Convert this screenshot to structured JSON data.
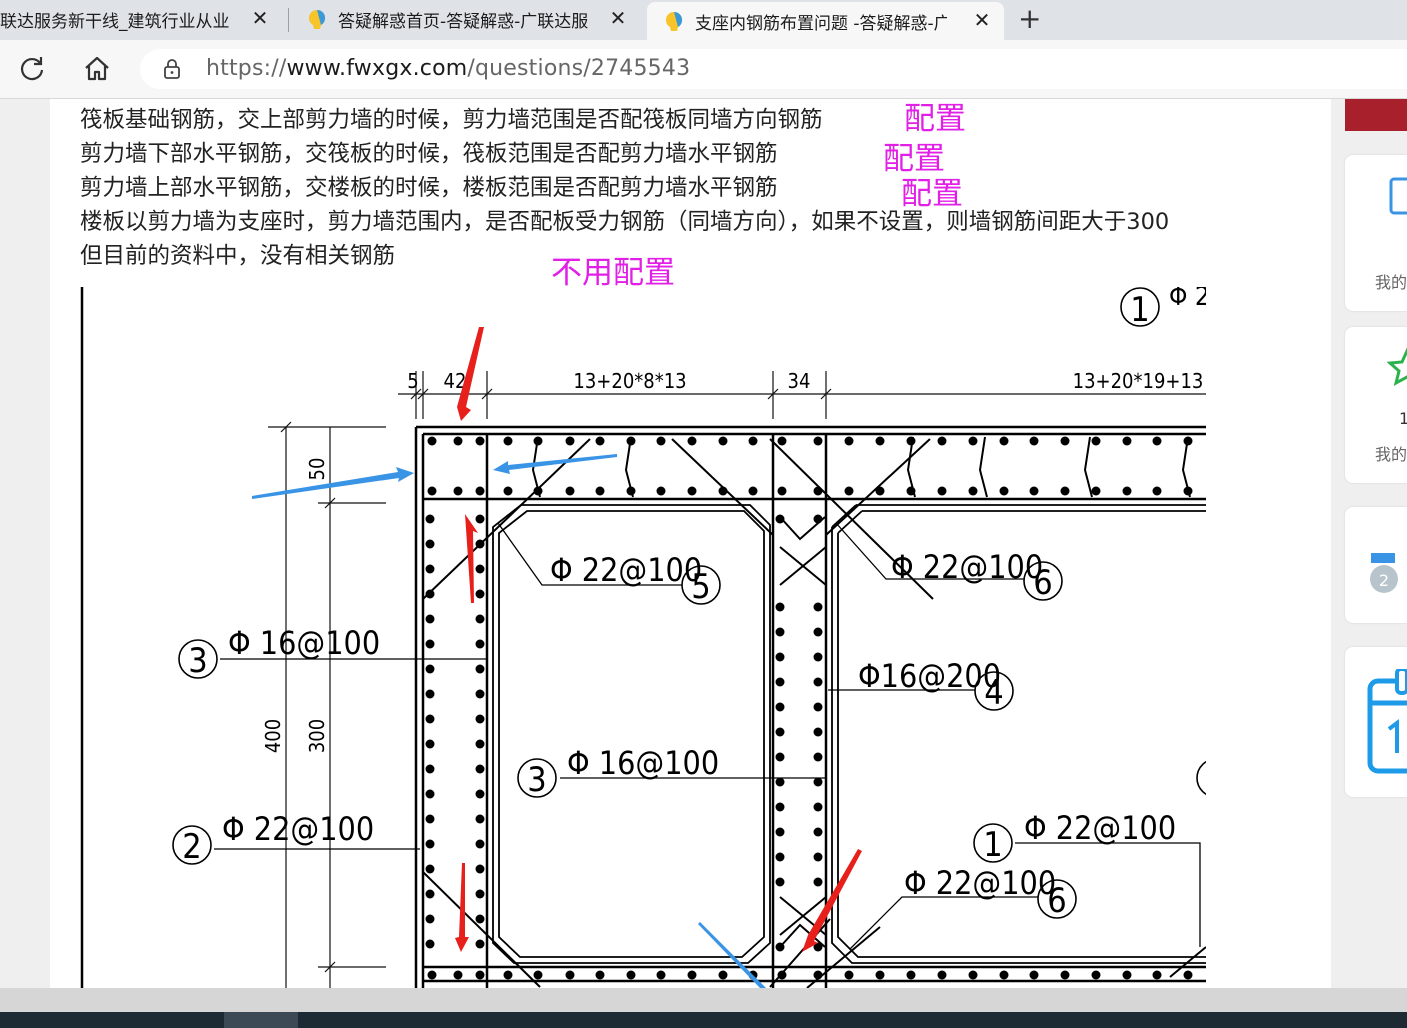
{
  "browser": {
    "tabs": [
      {
        "title": "联达服务新干线_建筑行业从业"
      },
      {
        "title": "答疑解惑首页-答疑解惑-广联达服"
      },
      {
        "title": "支座内钢筋布置问题 -答疑解惑-广"
      }
    ],
    "url": {
      "scheme": "https://",
      "host": "www.fwxgx.com",
      "path": "/questions/2745543"
    }
  },
  "question": {
    "lines": [
      "筏板基础钢筋，交上部剪力墙的时候，剪力墙范围是否配筏板同墙方向钢筋",
      "剪力墙下部水平钢筋，交筏板的时候，筏板范围是否配剪力墙水平钢筋",
      "剪力墙上部水平钢筋，交楼板的时候，楼板范围是否配剪力墙水平钢筋",
      "楼板以剪力墙为支座时，剪力墙范围内，是否配板受力钢筋（同墙方向），如果不设置，则墙钢筋间距大于300",
      "但目前的资料中，没有相关钢筋"
    ],
    "notes": [
      "配置",
      "配置",
      "配置",
      "不用配置"
    ],
    "note_color": "#e21fe6"
  },
  "drawing": {
    "dims_top": [
      "5",
      "42",
      "13+20*8*13",
      "34",
      "13+20*19+13"
    ],
    "dims_left": [
      "50",
      "400",
      "300"
    ],
    "callouts": [
      {
        "num": "1",
        "spec": "Φ 2"
      },
      {
        "num": "5",
        "spec": "Φ 22@100"
      },
      {
        "num": "6",
        "spec": "Φ 22@100"
      },
      {
        "num": "3",
        "spec": "Φ 16@100"
      },
      {
        "num": "4",
        "spec": "Φ16@200"
      },
      {
        "num": "3",
        "spec": "Φ 16@100"
      },
      {
        "num": "2",
        "spec": "Φ 22@100"
      },
      {
        "num": "1",
        "spec": "Φ 22@100"
      },
      {
        "num": "6",
        "spec": "Φ 22@100"
      }
    ]
  },
  "sidebar": {
    "labels": [
      "我的",
      "1",
      "我的"
    ]
  }
}
